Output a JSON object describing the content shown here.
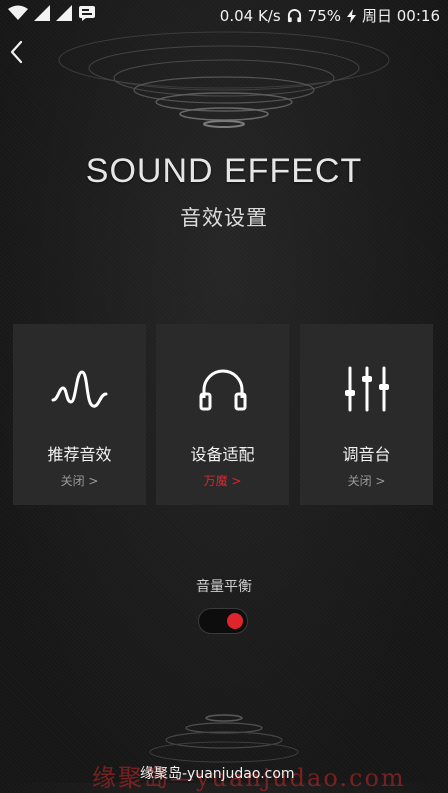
{
  "status_bar": {
    "network_speed": "0.04 K/s",
    "battery": "75%",
    "clock": "周日 00:16",
    "icons": [
      "wifi-icon",
      "signal-icon",
      "signal-icon",
      "notification-icon",
      "headphones-icon",
      "charging-icon"
    ]
  },
  "header": {
    "back_icon": "chevron-left-icon",
    "title_en": "SOUND EFFECT",
    "title_cn": "音效设置"
  },
  "cards": [
    {
      "label": "推荐音效",
      "status": "关闭 >",
      "icon": "waveform-icon",
      "active": false
    },
    {
      "label": "设备适配",
      "status": "万魔 >",
      "icon": "headphones-icon",
      "active": true
    },
    {
      "label": "调音台",
      "status": "关闭 >",
      "icon": "equalizer-icon",
      "active": false
    }
  ],
  "balance": {
    "label": "音量平衡",
    "toggle_on": true
  },
  "watermark": {
    "big": "缘聚岛—yuanjudao.com",
    "small": "缘聚岛-yuanjudao.com"
  },
  "colors": {
    "accent": "#e0242b",
    "background": "#1c1c1c",
    "card": "#2a2a2a"
  }
}
